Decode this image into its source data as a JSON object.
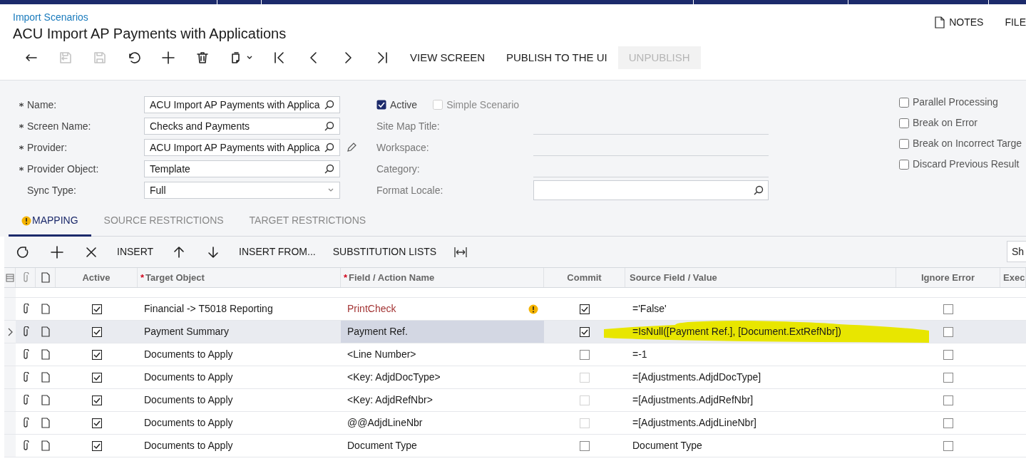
{
  "header": {
    "breadcrumb": "Import Scenarios",
    "title": "ACU Import AP Payments with Applications",
    "notes": "NOTES",
    "files": "FILE"
  },
  "toolbar": {
    "icons": [
      {
        "kind": "back",
        "disabled": false
      },
      {
        "kind": "save-close",
        "disabled": true
      },
      {
        "kind": "save",
        "disabled": true
      },
      {
        "kind": "undo",
        "disabled": false
      },
      {
        "kind": "add",
        "disabled": false
      },
      {
        "kind": "delete",
        "disabled": false
      },
      {
        "kind": "copy",
        "disabled": false
      },
      {
        "kind": "first",
        "disabled": false
      },
      {
        "kind": "prev",
        "disabled": false
      },
      {
        "kind": "next",
        "disabled": false
      },
      {
        "kind": "last",
        "disabled": false
      }
    ],
    "buttons": [
      {
        "label": "VIEW SCREEN",
        "disabled": false
      },
      {
        "label": "PUBLISH TO THE UI",
        "disabled": false
      },
      {
        "label": "UNPUBLISH",
        "disabled": true
      }
    ]
  },
  "form": {
    "fields": [
      {
        "label": "Name:",
        "required": true,
        "value": "ACU Import AP Payments with Applica",
        "kind": "lookup",
        "edit": false
      },
      {
        "label": "Screen Name:",
        "required": true,
        "value": "Checks and Payments",
        "kind": "lookup",
        "edit": false
      },
      {
        "label": "Provider:",
        "required": true,
        "value": "ACU Import AP Payments with Applica",
        "kind": "lookup",
        "edit": true
      },
      {
        "label": "Provider Object:",
        "required": true,
        "value": "Template",
        "kind": "lookup",
        "edit": false
      },
      {
        "label": "Sync Type:",
        "required": false,
        "value": "Full",
        "kind": "select",
        "edit": false
      }
    ],
    "flags": [
      {
        "label": "Active",
        "checked": true,
        "disabled": false
      },
      {
        "label": "Simple Scenario",
        "checked": false,
        "disabled": true
      }
    ],
    "middle_fields": [
      {
        "label": "Site Map Title:",
        "kind": "line"
      },
      {
        "label": "Workspace:",
        "kind": "line"
      },
      {
        "label": "Category:",
        "kind": "line"
      },
      {
        "label": "Format Locale:",
        "kind": "lookup"
      }
    ],
    "options": [
      {
        "label": "Parallel Processing",
        "checked": false
      },
      {
        "label": "Break on Error",
        "checked": false
      },
      {
        "label": "Break on Incorrect Targe",
        "checked": false
      },
      {
        "label": "Discard Previous Result",
        "checked": false
      }
    ]
  },
  "tabs": [
    {
      "label": "MAPPING",
      "selected": true,
      "warning": true
    },
    {
      "label": "SOURCE RESTRICTIONS",
      "selected": false,
      "warning": false
    },
    {
      "label": "TARGET RESTRICTIONS",
      "selected": false,
      "warning": false
    }
  ],
  "grid_toolbar": {
    "icons": [
      {
        "kind": "refresh"
      },
      {
        "kind": "add"
      },
      {
        "kind": "remove"
      }
    ],
    "insert": "INSERT",
    "moves": [
      {
        "kind": "up"
      },
      {
        "kind": "down"
      }
    ],
    "buttons": [
      "INSERT FROM...",
      "SUBSTITUTION LISTS"
    ],
    "fit": true,
    "right_button": "Sh"
  },
  "table": {
    "columns": [
      {
        "label": "Active"
      },
      {
        "label": "Target Object",
        "required_mark": "*"
      },
      {
        "label": "Field / Action Name",
        "required_mark": "*"
      },
      {
        "label": "Commit"
      },
      {
        "label": "Source Field / Value"
      },
      {
        "label": "Ignore Error"
      },
      {
        "label": "Exec"
      }
    ],
    "rows": [
      {
        "active": true,
        "target": "Financial -> T5018 Reporting",
        "field": "PrintCheck",
        "kind": "action",
        "warning": true,
        "commit": true,
        "commit_enabled": true,
        "source": "='False'",
        "ignore_error": false,
        "selected": false,
        "highlighted": false
      },
      {
        "active": true,
        "target": "Payment Summary",
        "field": "Payment Ref.",
        "kind": "field",
        "warning": false,
        "commit": true,
        "commit_enabled": true,
        "source": "=IsNull([Payment Ref.], [Document.ExtRefNbr])",
        "ignore_error": false,
        "selected": true,
        "highlighted": true
      },
      {
        "active": true,
        "target": "Documents to Apply",
        "field": "<Line Number>",
        "kind": "field",
        "warning": false,
        "commit": false,
        "commit_enabled": true,
        "source": "=-1",
        "ignore_error": false,
        "selected": false,
        "highlighted": false
      },
      {
        "active": true,
        "target": "Documents to Apply",
        "field": "<Key: AdjdDocType>",
        "kind": "field",
        "warning": false,
        "commit": false,
        "commit_enabled": false,
        "source": "=[Adjustments.AdjdDocType]",
        "ignore_error": false,
        "selected": false,
        "highlighted": false
      },
      {
        "active": true,
        "target": "Documents to Apply",
        "field": "<Key: AdjdRefNbr>",
        "kind": "field",
        "warning": false,
        "commit": false,
        "commit_enabled": false,
        "source": "=[Adjustments.AdjdRefNbr]",
        "ignore_error": false,
        "selected": false,
        "highlighted": false
      },
      {
        "active": true,
        "target": "Documents to Apply",
        "field": "@@AdjdLineNbr",
        "kind": "field",
        "warning": false,
        "commit": false,
        "commit_enabled": false,
        "source": "=[Adjustments.AdjdLineNbr]",
        "ignore_error": false,
        "selected": false,
        "highlighted": false
      },
      {
        "active": true,
        "target": "Documents to Apply",
        "field": "Document Type",
        "kind": "field",
        "warning": false,
        "commit": false,
        "commit_enabled": true,
        "source": "Document Type",
        "ignore_error": false,
        "selected": false,
        "highlighted": false
      }
    ]
  }
}
